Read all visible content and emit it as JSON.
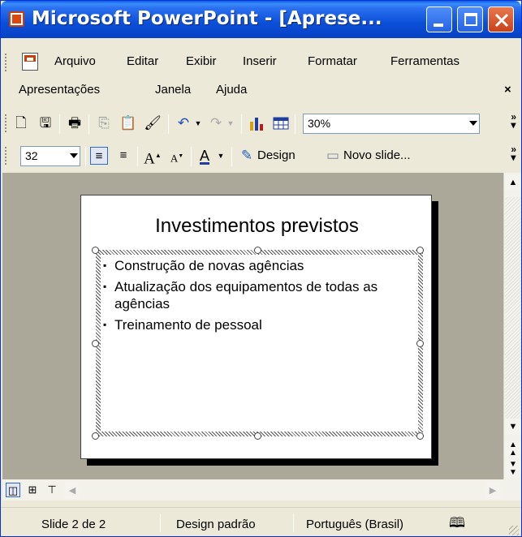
{
  "window": {
    "title": "Microsoft PowerPoint - [Aprese...",
    "accent": "#0a4fd8"
  },
  "menu": {
    "items_row1": [
      "Arquivo",
      "Editar",
      "Exibir",
      "Inserir",
      "Formatar",
      "Ferramentas"
    ],
    "items_row2": [
      "Apresentações",
      "Janela",
      "Ajuda"
    ],
    "doc_close": "×"
  },
  "toolbar_standard": {
    "zoom": "30%"
  },
  "toolbar_format": {
    "font_size": "32",
    "design_label": "Design",
    "new_slide_label": "Novo slide..."
  },
  "slide": {
    "title": "Investimentos previstos",
    "bullets": [
      "Construção de novas agências",
      "Atualização dos equipamentos de todas as agências",
      "Treinamento de pessoal"
    ]
  },
  "statusbar": {
    "slide_info": "Slide 2 de 2",
    "design": "Design padrão",
    "language": "Português (Brasil)"
  }
}
